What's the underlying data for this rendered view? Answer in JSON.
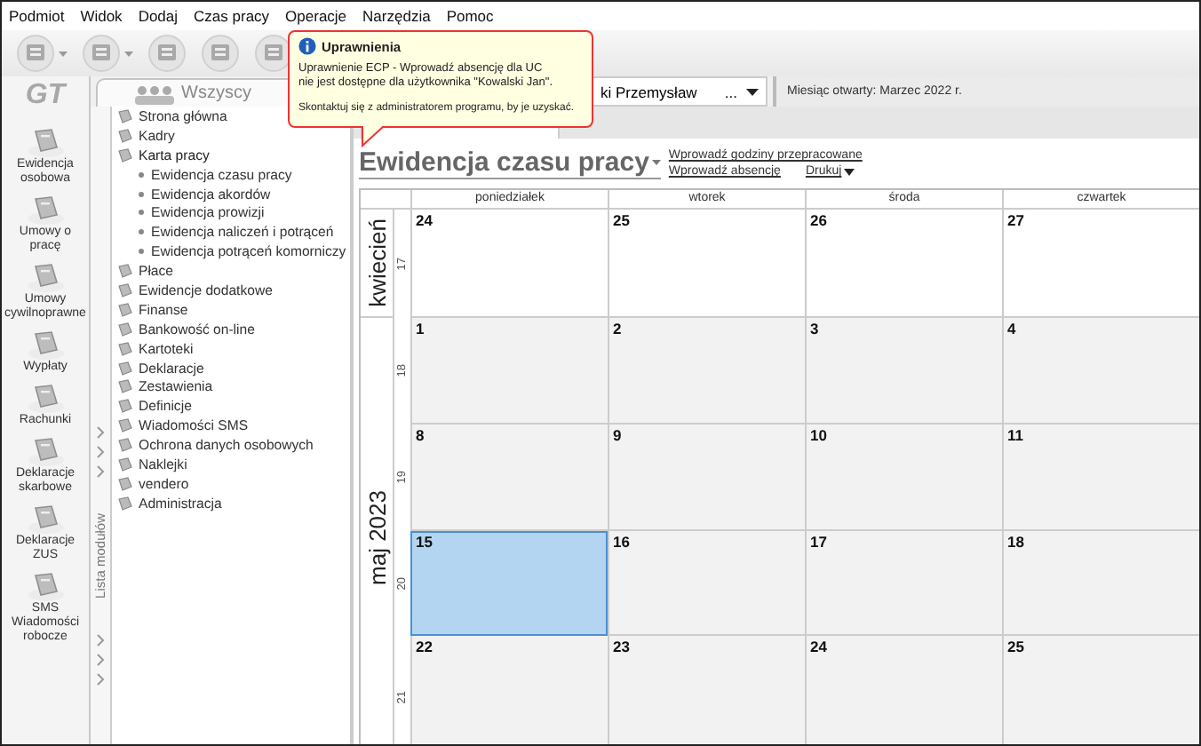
{
  "menu": [
    "Podmiot",
    "Widok",
    "Dodaj",
    "Czas pracy",
    "Operacje",
    "Narzędzia",
    "Pomoc"
  ],
  "toolbar": [
    {
      "dropdown": true
    },
    {
      "dropdown": true
    },
    {
      "dropdown": false
    },
    {
      "dropdown": false
    },
    {
      "dropdown": false
    }
  ],
  "logo": "GT",
  "group_tab": {
    "label": "Wszyscy",
    "selected": true
  },
  "employee_selector": {
    "value": "ki Przemysław",
    "button": "..."
  },
  "open_month": "Miesiąc otwarty: Marzec 2022 r.",
  "modules": [
    "Ewidencja osobowa",
    "Umowy o pracę",
    "Umowy cywilnoprawne",
    "Wypłaty",
    "Rachunki",
    "Deklaracje skarbowe",
    "Deklaracje ZUS",
    "SMS Wiadomości robocze"
  ],
  "module_list_label": "Lista modułów",
  "tree": [
    {
      "label": "Strona główna",
      "expanded": false
    },
    {
      "label": "Kadry",
      "expanded": false
    },
    {
      "label": "Karta pracy",
      "expanded": true,
      "children": [
        {
          "label": "Ewidencja czasu pracy"
        },
        {
          "label": "Ewidencja akordów"
        },
        {
          "label": "Ewidencja prowizji"
        },
        {
          "label": "Ewidencja naliczeń i potrąceń"
        },
        {
          "label": "Ewidencja potrąceń komorniczy"
        }
      ]
    },
    {
      "label": "Płace",
      "expanded": false
    },
    {
      "label": "Ewidencje dodatkowe",
      "expanded": false
    },
    {
      "label": "Finanse",
      "expanded": false
    },
    {
      "label": "Bankowość on-line",
      "expanded": false
    },
    {
      "label": "Kartoteki",
      "expanded": false
    },
    {
      "label": "Deklaracje",
      "expanded": false
    },
    {
      "label": "Zestawienia",
      "expanded": false
    },
    {
      "label": "Definicje",
      "expanded": false
    },
    {
      "label": "Wiadomości SMS",
      "expanded": false
    },
    {
      "label": "Ochrona danych osobowych",
      "expanded": false
    },
    {
      "label": "Naklejki",
      "expanded": false
    },
    {
      "label": "vendero",
      "expanded": false
    },
    {
      "label": "Administracja",
      "expanded": false
    }
  ],
  "page_title": "Ewidencja czasu pracy",
  "actions": [
    {
      "label": "Wprowadź godziny przepracowane",
      "dropdown": false
    },
    {
      "label": "Wprowadź absencję",
      "dropdown": false
    },
    {
      "label": "Drukuj",
      "dropdown": true
    }
  ],
  "calendar": {
    "weekdays": [
      "poniedziałek",
      "wtorek",
      "środa",
      "czwartek"
    ],
    "months": [
      {
        "label": "kwiecień",
        "weeks": [
          {
            "number": "17",
            "days": [
              {
                "day": "24",
                "in_month": false,
                "selected": false
              },
              {
                "day": "25",
                "in_month": false,
                "selected": false
              },
              {
                "day": "26",
                "in_month": false,
                "selected": false
              },
              {
                "day": "27",
                "in_month": false,
                "selected": false
              }
            ]
          }
        ]
      },
      {
        "label": "maj 2023",
        "weeks": [
          {
            "number": "18",
            "days": [
              {
                "day": "1",
                "in_month": true,
                "selected": false
              },
              {
                "day": "2",
                "in_month": true,
                "selected": false
              },
              {
                "day": "3",
                "in_month": true,
                "selected": false
              },
              {
                "day": "4",
                "in_month": true,
                "selected": false
              }
            ]
          },
          {
            "number": "19",
            "days": [
              {
                "day": "8",
                "in_month": true,
                "selected": false
              },
              {
                "day": "9",
                "in_month": true,
                "selected": false
              },
              {
                "day": "10",
                "in_month": true,
                "selected": false
              },
              {
                "day": "11",
                "in_month": true,
                "selected": false
              }
            ]
          },
          {
            "number": "20",
            "days": [
              {
                "day": "15",
                "in_month": true,
                "selected": true
              },
              {
                "day": "16",
                "in_month": true,
                "selected": false
              },
              {
                "day": "17",
                "in_month": true,
                "selected": false
              },
              {
                "day": "18",
                "in_month": true,
                "selected": false
              }
            ]
          },
          {
            "number": "21",
            "days": [
              {
                "day": "22",
                "in_month": true,
                "selected": false
              },
              {
                "day": "23",
                "in_month": true,
                "selected": false
              },
              {
                "day": "24",
                "in_month": true,
                "selected": false
              },
              {
                "day": "25",
                "in_month": true,
                "selected": false
              }
            ]
          }
        ]
      }
    ]
  },
  "tooltip": {
    "title": "Uprawnienia",
    "message": "Uprawnienie ECP - Wprowadź absencję dla UC\nnie jest dostępne dla użytkownika \"Kowalski Jan\".",
    "hint": "Skontaktuj się z administratorem programu, by je uzyskać."
  }
}
